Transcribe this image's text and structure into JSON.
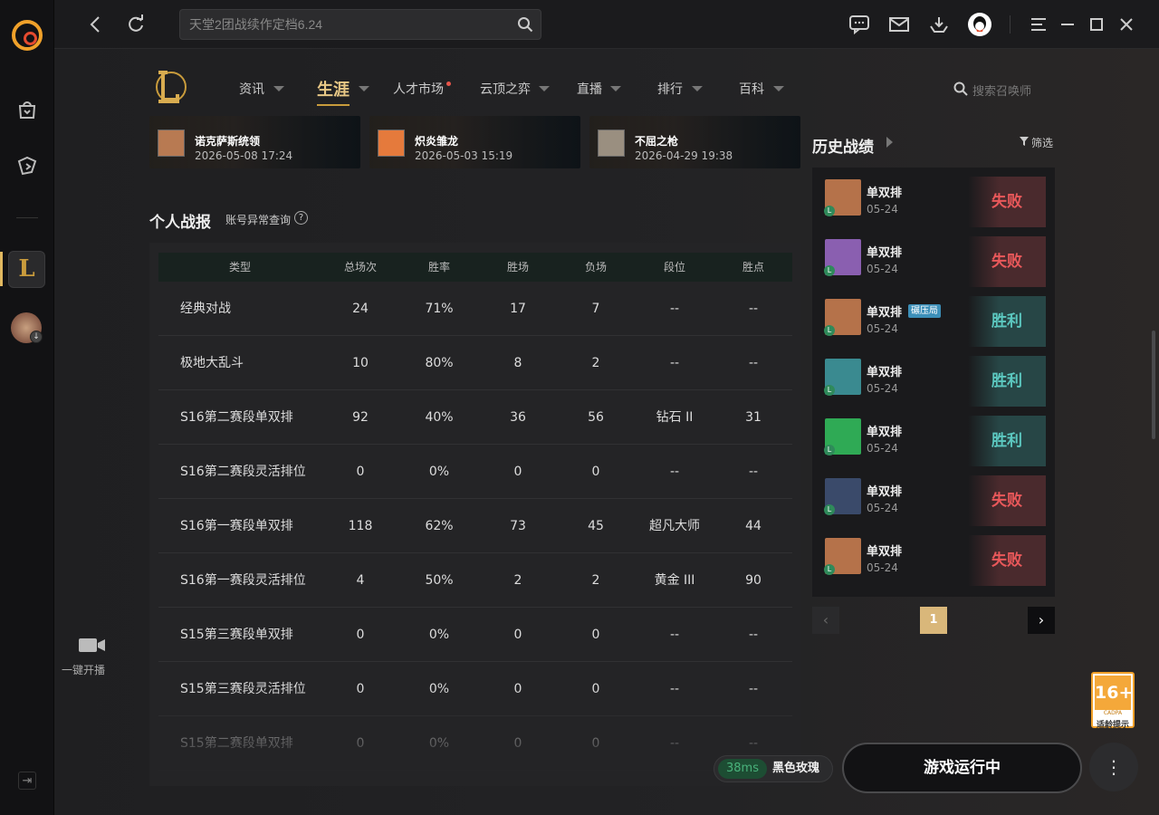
{
  "title_bar": {
    "search_placeholder": "天堂2团战续作定档6.24"
  },
  "rail": {
    "live_label": "一键开播"
  },
  "nav": {
    "items": [
      {
        "label": "资讯"
      },
      {
        "label": "生涯"
      },
      {
        "label": "人才市场"
      },
      {
        "label": "云顶之弈"
      },
      {
        "label": "直播"
      },
      {
        "label": "排行"
      },
      {
        "label": "百科"
      }
    ],
    "search_placeholder": "搜索召唤师"
  },
  "recent_cards": [
    {
      "name": "诺克萨斯统领",
      "time": "2026-05-08 17:24",
      "color": "#b87a52"
    },
    {
      "name": "炽炎雏龙",
      "time": "2026-05-03 15:19",
      "color": "#e57a3c"
    },
    {
      "name": "不屈之枪",
      "time": "2026-04-29 19:38",
      "color": "#9a8f80"
    }
  ],
  "stats": {
    "title": "个人战报",
    "link": "账号异常查询",
    "help": "?",
    "columns": [
      "类型",
      "总场次",
      "胜率",
      "胜场",
      "负场",
      "段位",
      "胜点"
    ],
    "rows": [
      [
        "经典对战",
        "24",
        "71%",
        "17",
        "7",
        "--",
        "--"
      ],
      [
        "极地大乱斗",
        "10",
        "80%",
        "8",
        "2",
        "--",
        "--"
      ],
      [
        "S16第二赛段单双排",
        "92",
        "40%",
        "36",
        "56",
        "钻石 II",
        "31"
      ],
      [
        "S16第二赛段灵活排位",
        "0",
        "0%",
        "0",
        "0",
        "--",
        "--"
      ],
      [
        "S16第一赛段单双排",
        "118",
        "62%",
        "73",
        "45",
        "超凡大师",
        "44"
      ],
      [
        "S16第一赛段灵活排位",
        "4",
        "50%",
        "2",
        "2",
        "黄金 III",
        "90"
      ],
      [
        "S15第三赛段单双排",
        "0",
        "0%",
        "0",
        "0",
        "--",
        "--"
      ],
      [
        "S15第三赛段灵活排位",
        "0",
        "0%",
        "0",
        "0",
        "--",
        "--"
      ],
      [
        "S15第二赛段单双排",
        "0",
        "0%",
        "0",
        "0",
        "--",
        "--"
      ]
    ]
  },
  "history": {
    "title": "历史战绩",
    "filter": "筛选",
    "matches": [
      {
        "mode": "单双排",
        "date": "05-24",
        "result": "失败",
        "win": false,
        "color": "#b5724a",
        "tag": ""
      },
      {
        "mode": "单双排",
        "date": "05-24",
        "result": "失败",
        "win": false,
        "color": "#8a5fb0",
        "tag": ""
      },
      {
        "mode": "单双排",
        "date": "05-24",
        "result": "胜利",
        "win": true,
        "color": "#b5724a",
        "tag": "碾压局"
      },
      {
        "mode": "单双排",
        "date": "05-24",
        "result": "胜利",
        "win": true,
        "color": "#3a8a90",
        "tag": ""
      },
      {
        "mode": "单双排",
        "date": "05-24",
        "result": "胜利",
        "win": true,
        "color": "#2faa55",
        "tag": ""
      },
      {
        "mode": "单双排",
        "date": "05-24",
        "result": "失败",
        "win": false,
        "color": "#3a4a6a",
        "tag": ""
      },
      {
        "mode": "单双排",
        "date": "05-24",
        "result": "失败",
        "win": false,
        "color": "#b5724a",
        "tag": ""
      }
    ],
    "page": "1"
  },
  "bottom": {
    "ping": "38ms",
    "server": "黑色玫瑰",
    "play_label": "游戏运行中",
    "more": "⋮"
  },
  "age_badge": {
    "num": "16+",
    "cadpa": "CADPA",
    "tip": "适龄提示"
  }
}
